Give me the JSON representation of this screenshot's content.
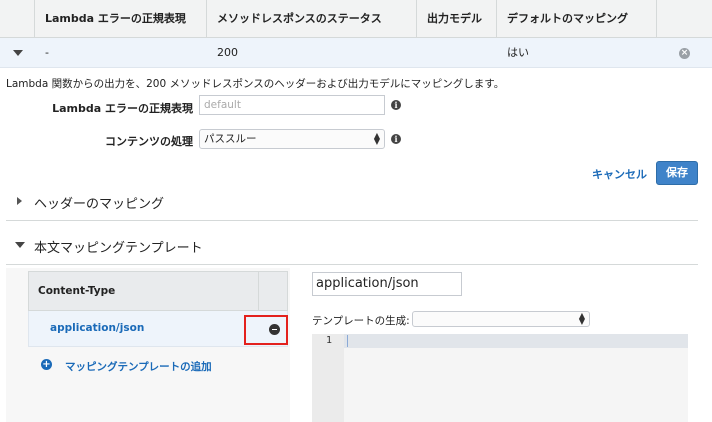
{
  "header": {
    "col_regex": "Lambda エラーの正規表現",
    "col_status": "メソッドレスポンスのステータス",
    "col_model": "出力モデル",
    "col_default": "デフォルトのマッピング"
  },
  "row": {
    "regex": "-",
    "status": "200",
    "default": "はい"
  },
  "description": "Lambda 関数からの出力を、200 メソッドレスポンスのヘッダーおよび出力モデルにマッピングします。",
  "form": {
    "regex_label": "Lambda エラーの正規表現",
    "regex_placeholder": "default",
    "content_label": "コンテンツの処理",
    "content_value": "パススルー"
  },
  "actions": {
    "cancel": "キャンセル",
    "save": "保存"
  },
  "sections": {
    "header_mapping": "ヘッダーのマッピング",
    "body_template": "本文マッピングテンプレート"
  },
  "templates": {
    "column": "Content-Type",
    "items": [
      "application/json"
    ],
    "add_label": "マッピングテンプレートの追加"
  },
  "editor": {
    "content_type_value": "application/json",
    "generate_label": "テンプレートの生成:",
    "generate_value": "",
    "line_number": "1"
  },
  "colors": {
    "link": "#1a6ab8",
    "save_button": "#3f83c9",
    "highlight_box": "#e3211d",
    "selected_row": "#eef4fb"
  }
}
